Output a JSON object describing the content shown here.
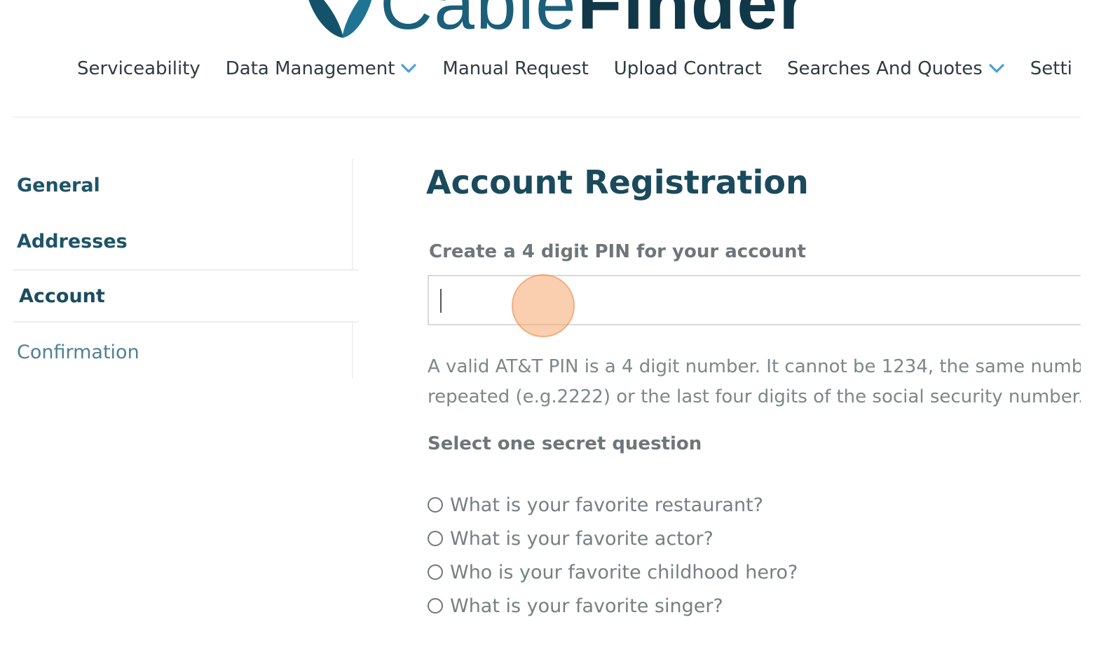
{
  "brand": {
    "logo_text_cable": "Cable",
    "logo_text_finder": "Finder",
    "colors": {
      "primary": "#1b5f7b",
      "dark": "#113848"
    }
  },
  "topnav": {
    "items": [
      {
        "label": "Serviceability",
        "dropdown": false
      },
      {
        "label": "Data Management",
        "dropdown": true
      },
      {
        "label": "Manual Request",
        "dropdown": false
      },
      {
        "label": "Upload Contract",
        "dropdown": false
      },
      {
        "label": "Searches And Quotes",
        "dropdown": true
      },
      {
        "label": "Setti",
        "dropdown": false
      }
    ],
    "chevron_icon": "chevron-down-icon",
    "chevron_color": "#4a9fd6"
  },
  "sidebar": {
    "items": [
      {
        "label": "General"
      },
      {
        "label": "Addresses"
      },
      {
        "label": "Account",
        "active": true
      },
      {
        "label": "Confirmation"
      }
    ]
  },
  "main": {
    "title": "Account Registration",
    "pin_label": "Create a 4 digit PIN for your account",
    "pin_value": "",
    "help_line1": "A valid AT&T PIN is a 4 digit number. It cannot be 1234, the same numb",
    "help_line2": "repeated (e.g.2222) or the last four digits of the social security number.",
    "secret_label": "Select one secret question",
    "questions": [
      "What is your favorite restaurant?",
      "What is your favorite actor?",
      "Who is your favorite childhood hero?",
      "What is your favorite singer?"
    ]
  }
}
